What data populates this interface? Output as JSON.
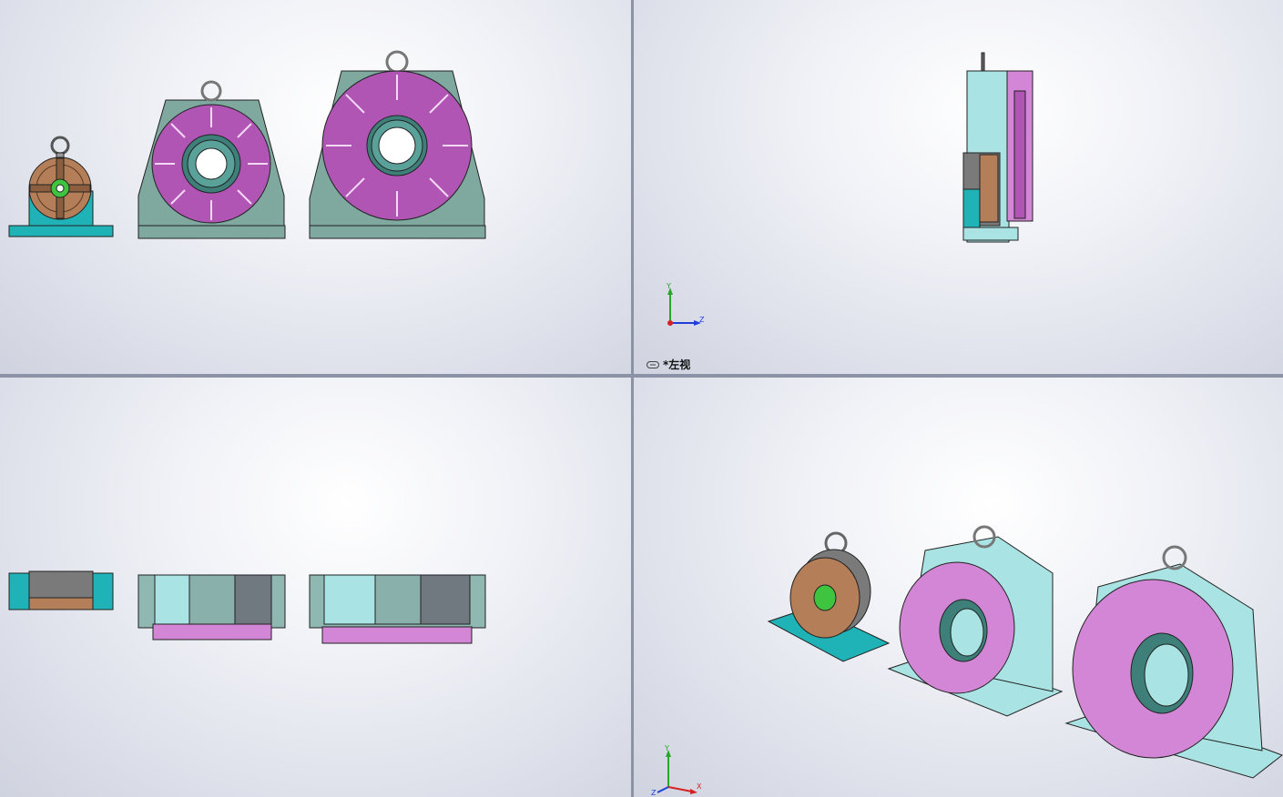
{
  "viewports": {
    "top_left": {
      "label": ""
    },
    "top_right": {
      "label": "*左视",
      "triad": {
        "y": "Y",
        "z": "Z"
      }
    },
    "bottom_left": {
      "label": ""
    },
    "bottom_right": {
      "label": "",
      "triad": {
        "y": "Y",
        "x": "X",
        "z": "Z"
      }
    }
  },
  "colors": {
    "purple_face": "#b055b4",
    "pink_face": "#d486d6",
    "teal_base": "#7fa89f",
    "cyan_base": "#a9e3e3",
    "bright_teal": "#1fb3b7",
    "bronze": "#b47f58",
    "green_bore": "#3ec43e",
    "axis_y": "#2aa52a",
    "axis_z": "#1f3fd8",
    "axis_x": "#d62222"
  }
}
